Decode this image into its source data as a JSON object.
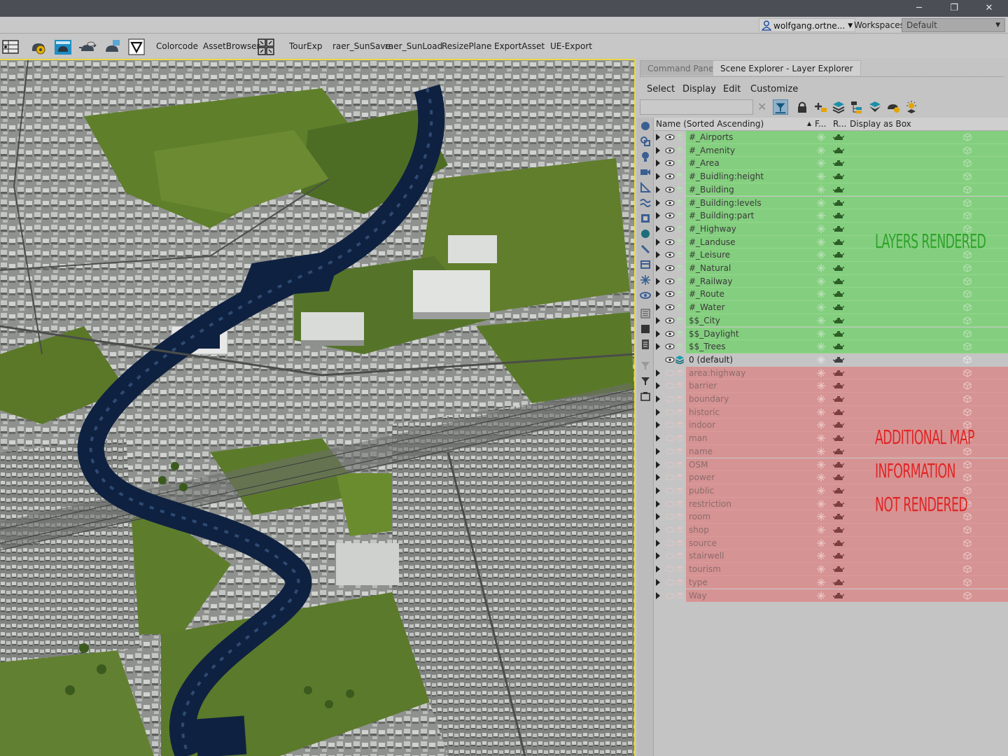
{
  "window": {
    "minimize_glyph": "─",
    "restore_glyph": "❐",
    "close_glyph": "✕"
  },
  "userbar": {
    "user_name": "wolfgang.ortne...",
    "user_caret": "▼",
    "workspaces_label": "Workspaces:",
    "workspace_value": "Default",
    "workspace_caret": "▼"
  },
  "toolbar": {
    "items": [
      "Colorcode",
      "AssetBrowser",
      "TourExp",
      "raer_SunSave",
      "raer_SunLoad",
      "ResizePlane",
      "ExportAsset",
      "UE-Export"
    ],
    "icons": [
      "scene-grid-icon",
      "teapot-gear-icon",
      "teapot-render-icon",
      "teapot-cloud-icon",
      "teapot-sky-icon",
      "triangle-v-icon",
      "grid-arrows-icon"
    ]
  },
  "panel": {
    "tabs": [
      "Command Panel",
      "Scene Explorer - Layer Explorer"
    ],
    "menus": [
      "Select",
      "Display",
      "Edit",
      "Customize"
    ],
    "clear_glyph": "✕",
    "columns": {
      "name": "Name (Sorted Ascending)",
      "sort_glyph": "▲",
      "frozen": "F...",
      "renderable": "R...",
      "display_box": "Display as Box"
    },
    "layers_rendered": [
      "#_Airports",
      "#_Amenity",
      "#_Area",
      "#_Buidling:height",
      "#_Building",
      "#_Building:levels",
      "#_Building:part",
      "#_Highway",
      "#_Landuse",
      "#_Leisure",
      "#_Natural",
      "#_Railway",
      "#_Route",
      "#_Water",
      "$$_City",
      "$$_Daylight",
      "$$_Trees"
    ],
    "default_layer": "0 (default)",
    "layers_not_rendered": [
      "area:highway",
      "barrier",
      "boundary",
      "historic",
      "indoor",
      "man",
      "name",
      "OSM",
      "power",
      "public",
      "restriction",
      "room",
      "shop",
      "source",
      "stairwell",
      "tourism",
      "type",
      "Way"
    ]
  },
  "annotations": {
    "rendered": "LAYERS RENDERED",
    "not_rendered_1": "ADDITIONAL MAP",
    "not_rendered_2": "INFORMATION",
    "not_rendered_3": "NOT RENDERED"
  },
  "colors": {
    "rendered_highlight": "#84cf7f",
    "not_rendered_highlight": "#d69393",
    "annotation_green": "#2fa12a",
    "annotation_red": "#e02525",
    "viewport_border": "#e8d84a",
    "river": "#0f2140",
    "grass": "#5d7a2c"
  }
}
